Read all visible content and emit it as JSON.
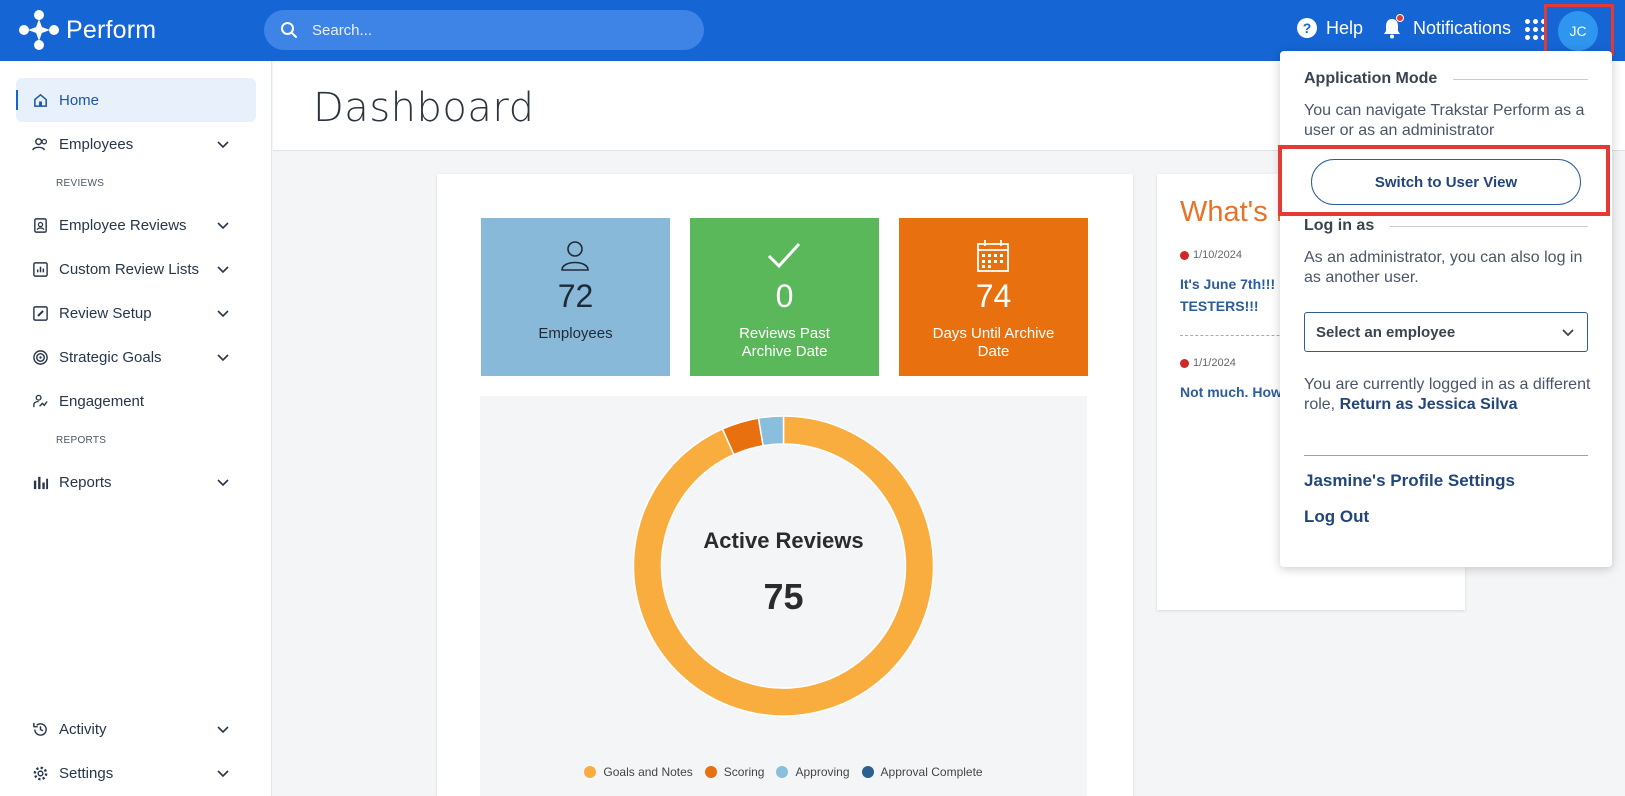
{
  "header": {
    "app_name": "Perform",
    "search_placeholder": "Search...",
    "help_label": "Help",
    "notifications_label": "Notifications",
    "avatar_initials": "JC"
  },
  "sidebar": {
    "home": "Home",
    "employees": "Employees",
    "reviews_section": "REVIEWS",
    "employee_reviews": "Employee Reviews",
    "custom_review_lists": "Custom Review Lists",
    "review_setup": "Review Setup",
    "strategic_goals": "Strategic Goals",
    "engagement": "Engagement",
    "reports_section": "REPORTS",
    "reports": "Reports",
    "activity": "Activity",
    "settings": "Settings"
  },
  "page": {
    "title": "Dashboard"
  },
  "tiles": [
    {
      "value": "72",
      "label": "Employees",
      "color": "#89b9d9",
      "icon": "person-icon"
    },
    {
      "value": "0",
      "label": "Reviews Past Archive Date",
      "color": "#5bb85a",
      "icon": "checkmark-icon"
    },
    {
      "value": "74",
      "label": "Days Until Archive Date",
      "color": "#e8700f",
      "icon": "calendar-icon"
    }
  ],
  "active_reviews": {
    "title": "Active Reviews",
    "total": "75"
  },
  "chart_data": {
    "type": "pie",
    "title": "Active Reviews",
    "categories": [
      "Goals and Notes",
      "Scoring",
      "Approving",
      "Approval Complete"
    ],
    "values": [
      70,
      3,
      2,
      0
    ],
    "colors": [
      "#f9ad3f",
      "#e8700f",
      "#89bedc",
      "#2d5f8f"
    ],
    "legend": "bottom"
  },
  "news": {
    "title": "What's New",
    "posts": [
      {
        "date": "1/10/2024",
        "text_line1": "It's June 7th!!!",
        "text_line2": "TESTERS!!!"
      },
      {
        "date": "1/1/2024",
        "text_line1": "Not much. How"
      }
    ]
  },
  "panel": {
    "app_mode_heading": "Application Mode",
    "app_mode_text": "You can navigate Trakstar Perform as a user or as an administrator",
    "switch_button": "Switch to User View",
    "login_as_heading": "Log in as",
    "login_as_text": "As an administrator, you can also log in as another user.",
    "select_employee": "Select an employee",
    "logged_in_text": "You are currently logged in as a different role, ",
    "return_link": "Return as Jessica Silva",
    "profile_settings": "Jasmine's Profile Settings",
    "log_out": "Log Out"
  }
}
